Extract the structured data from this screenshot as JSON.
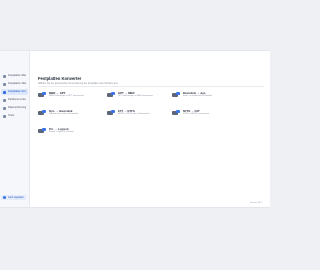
{
  "sidebar": {
    "items": [
      {
        "label": "Festplatten-Manager",
        "active": false
      },
      {
        "label": "Festplatten-Status",
        "active": false
      },
      {
        "label": "Festplatten-Konverter",
        "active": true
      },
      {
        "label": "Partitionen-Verwaltung",
        "active": false
      },
      {
        "label": "Datensicherung & Klonen",
        "active": false
      },
      {
        "label": "Tools",
        "active": false
      }
    ],
    "footer": {
      "label": "Jetzt upgraden"
    }
  },
  "main": {
    "title": "Festplatten Konverter",
    "subtitle": "Wählen Sie die gewünschte Konvertierung der Festplatte oder Partition aus.",
    "cards": [
      {
        "title": "MBR → GPT",
        "desc": "MBR-Datenträger in GPT konvertieren"
      },
      {
        "title": "GPT → MBR",
        "desc": "GPT-Datenträger in MBR konvertieren"
      },
      {
        "title": "Basisdisk → dyn.",
        "desc": "Basis- in dynamische Festplatte"
      },
      {
        "title": "Dyn. → Basisdisk",
        "desc": "Dynamische in Basis-Festplatte"
      },
      {
        "title": "FAT → NTFS",
        "desc": "FAT32 in NTFS ohne Datenverlust"
      },
      {
        "title": "NTFS → FAT",
        "desc": "NTFS in FAT32 konvertieren"
      },
      {
        "title": "Pri. → Logisch",
        "desc": "Primär in logische Partition"
      }
    ]
  },
  "status": {
    "text": "Version 18.0"
  }
}
